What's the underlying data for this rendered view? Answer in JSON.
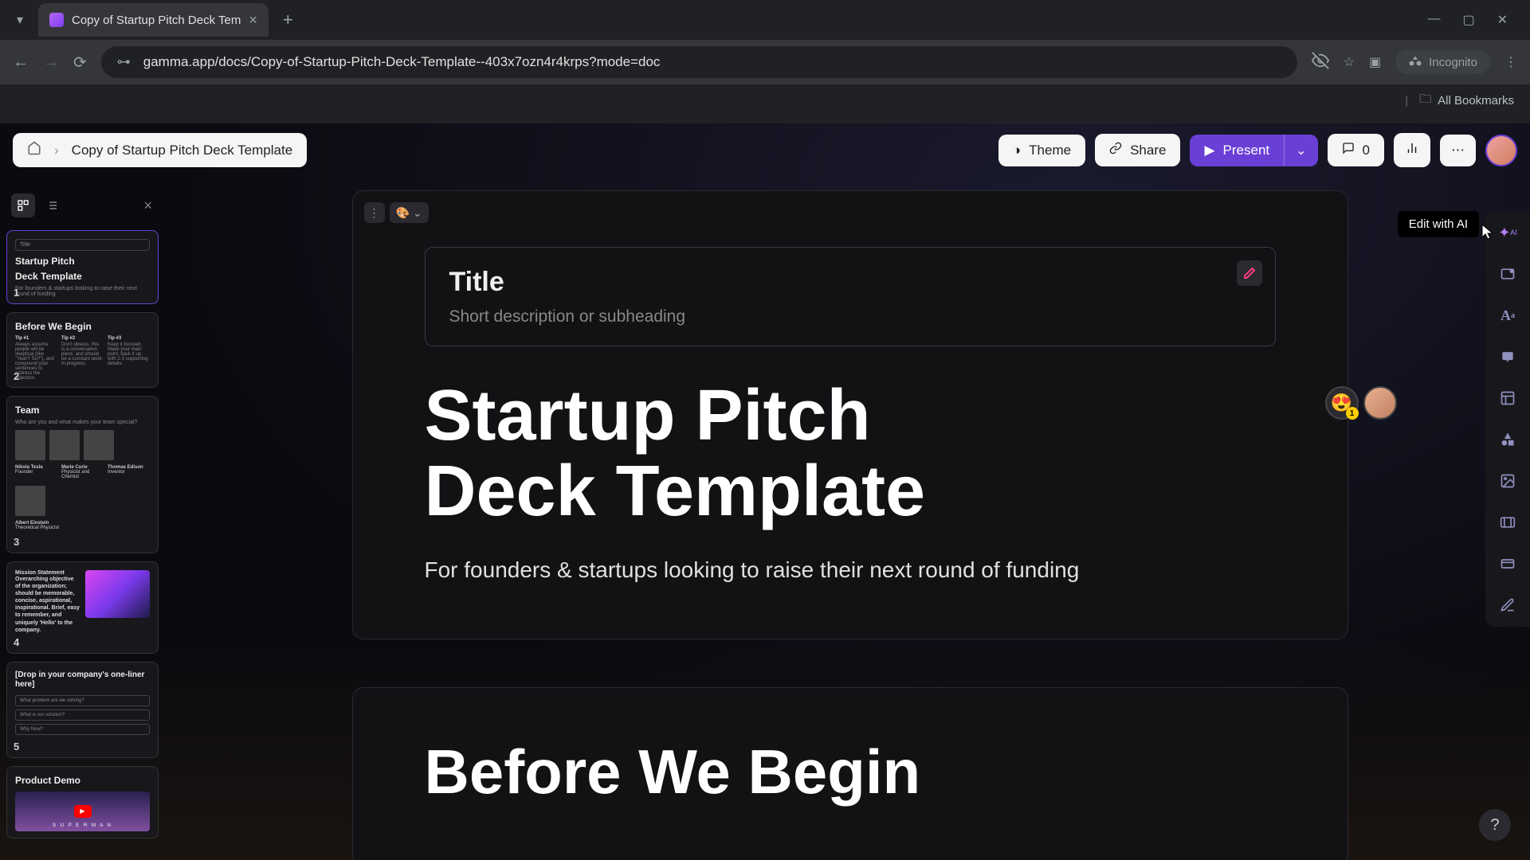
{
  "browser": {
    "tab_title": "Copy of Startup Pitch Deck Tem",
    "url": "gamma.app/docs/Copy-of-Startup-Pitch-Deck-Template--403x7ozn4r4krps?mode=doc",
    "incognito_label": "Incognito",
    "all_bookmarks": "All Bookmarks"
  },
  "header": {
    "breadcrumb_title": "Copy of Startup Pitch Deck Template",
    "theme": "Theme",
    "share": "Share",
    "present": "Present",
    "comment_count": "0"
  },
  "rail": {
    "tooltip": "Edit with AI"
  },
  "slide1": {
    "box_label": "Title",
    "box_sub": "Short description or subheading",
    "heading_l1": "Startup Pitch",
    "heading_l2": "Deck Template",
    "sub": "For founders & startups looking to raise their next round of funding"
  },
  "slide2_heading": "Before We Begin",
  "thumbs": {
    "t1": {
      "box": "Title",
      "h1": "Startup Pitch",
      "h2": "Deck Template",
      "sub": "For founders & startups looking to raise their next round of funding"
    },
    "t2": {
      "title": "Before We Begin",
      "c1h": "Tip #1",
      "c1t": "Always assume people will be skeptical (like \"Yeah? So?\"), and compound your sentences to address the objection.",
      "c2h": "Tip #2",
      "c2t": "Don't obsess, this is a conversation piece, and should be a constant work-in-progress.",
      "c3h": "Tip #3",
      "c3t": "Keep it focused. Make your main point, back it up with 2-3 supporting details."
    },
    "t3": {
      "title": "Team",
      "sub": "Who are you and what makes your team special?",
      "p1": "Nikola Tesla",
      "p1r": "Founder",
      "p2": "Marie Curie",
      "p2r": "Physicist and Chemist",
      "p3": "Thomas Edison",
      "p3r": "Inventor",
      "p4": "Albert Einstein",
      "p4r": "Theoretical Physicist"
    },
    "t4": {
      "label": "Mission Statement",
      "text": "Overarching objective of the organization; should be memorable, concise, aspirational, inspirational. Brief, easy to remember, and uniquely 'Hello' to the company."
    },
    "t5": {
      "title": "[Drop in your company's one-liner here]",
      "l1": "What problem are we solving?",
      "l2": "What is our solution?",
      "l3": "Why Now?"
    },
    "t6": {
      "title": "Product Demo",
      "video_text": "S U P E R  M A N"
    }
  },
  "react_badge": "1"
}
